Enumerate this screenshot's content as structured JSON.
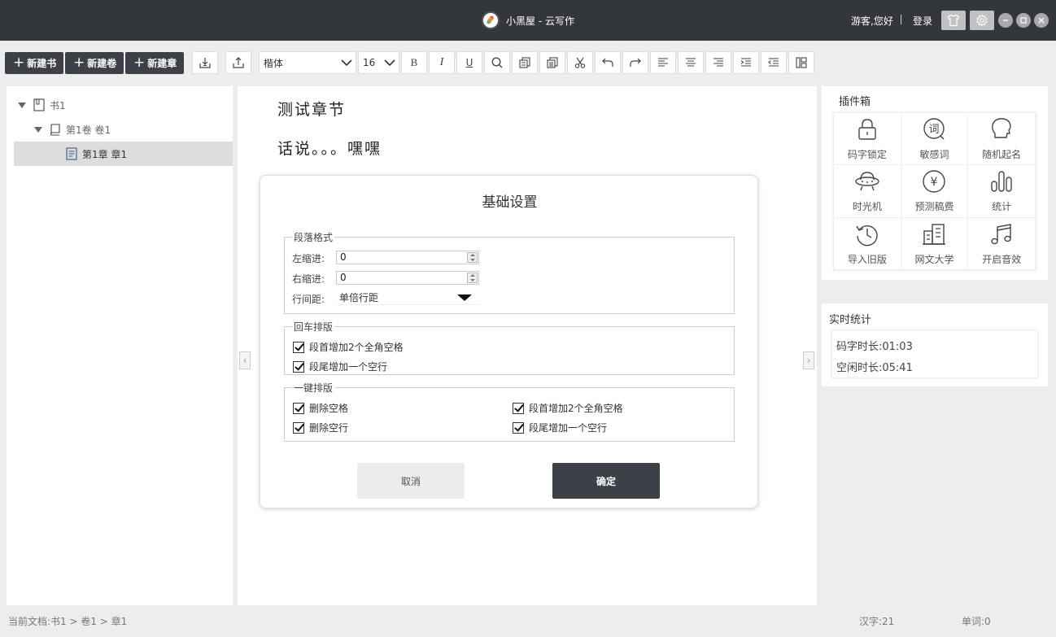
{
  "titlebar": {
    "title": "小黑屋 - 云写作",
    "greeting": "游客,您好",
    "login": "登录"
  },
  "toolbar": {
    "new_book": "新建书",
    "new_volume": "新建卷",
    "new_chapter": "新建章",
    "font": "楷体",
    "font_size": "16",
    "bold": "B",
    "italic": "I",
    "underline": "U"
  },
  "tree": {
    "book": "书1",
    "volume": "第1卷  卷1",
    "chapter": "第1章  章1"
  },
  "editor": {
    "chapter_title": "测试章节",
    "body": "话说。。。嘿嘿"
  },
  "dialog": {
    "title": "基础设置",
    "paragraph_group": "段落格式",
    "left_indent_label": "左缩进:",
    "left_indent_value": "0",
    "right_indent_label": "右缩进:",
    "right_indent_value": "0",
    "line_spacing_label": "行间距:",
    "line_spacing_value": "单倍行距",
    "enter_group": "回车排版",
    "enter_opt1": "段首增加2个全角空格",
    "enter_opt2": "段尾增加一个空行",
    "oneclick_group": "一键排版",
    "oc_opt1": "删除空格",
    "oc_opt2": "删除空行",
    "oc_opt3": "段首增加2个全角空格",
    "oc_opt4": "段尾增加一个空行",
    "cancel": "取消",
    "confirm": "确定"
  },
  "plugins": {
    "title": "插件箱",
    "items": [
      {
        "label": "码字锁定",
        "icon": "lock-icon"
      },
      {
        "label": "敏感词",
        "icon": "sensitive-word-icon"
      },
      {
        "label": "随机起名",
        "icon": "head-icon"
      },
      {
        "label": "时光机",
        "icon": "ufo-icon"
      },
      {
        "label": "预测稿费",
        "icon": "yen-icon"
      },
      {
        "label": "统计",
        "icon": "bar-chart-icon"
      },
      {
        "label": "导入旧版",
        "icon": "history-icon"
      },
      {
        "label": "网文大学",
        "icon": "building-icon"
      },
      {
        "label": "开启音效",
        "icon": "music-icon"
      }
    ]
  },
  "stats": {
    "title": "实时统计",
    "typing_time": "码字时长:01:03",
    "idle_time": "空闲时长:05:41"
  },
  "status": {
    "current_doc": "当前文档:书1 > 卷1 > 章1",
    "chars": "汉字:21",
    "words": "单词:0"
  }
}
